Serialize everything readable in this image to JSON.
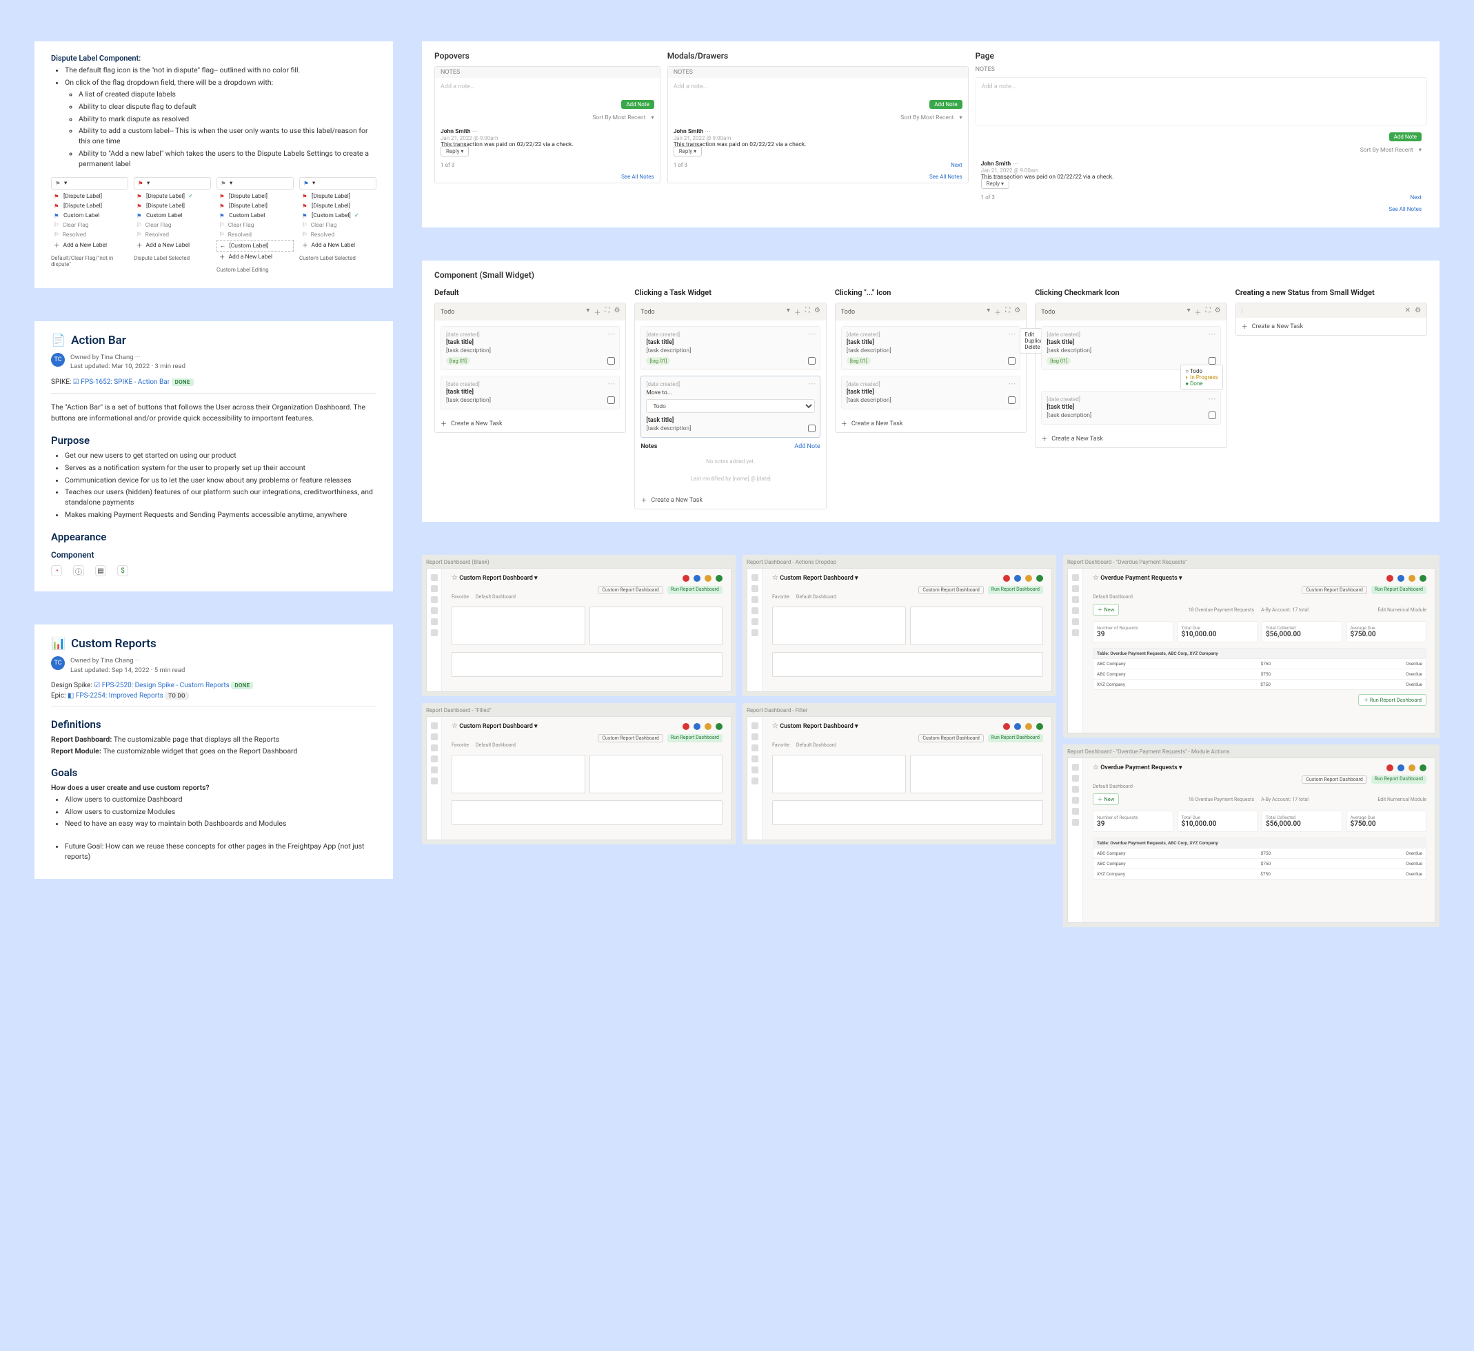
{
  "dispute": {
    "title": "Dispute Label Component:",
    "b1": "The default flag icon is the \"not in dispute\" flag-- outlined with no color fill.",
    "b2": "On click of the flag dropdown field, there will be a dropdown with:",
    "sub1": "A list of created dispute labels",
    "sub2": "Ability to clear dispute flag to default",
    "sub3": "Ability to mark dispute as resolved",
    "sub4": "Ability to add a custom label-- This is when the user only wants to use this label/reason for this one time",
    "sub5": "Ability to \"Add a new label\" which takes the users to the Dispute Labels Settings to create a permanent label",
    "labels": {
      "disp": "[Dispute Label]",
      "custom": "Custom Label",
      "custom_br": "[Custom Label]",
      "clear": "Clear Flag",
      "resolved": "Resolved",
      "addnew": "Add a New Label",
      "cap1": "Default/Clear Flag/\"not in dispute\"",
      "cap2": "Dispute Label Selected",
      "cap3": "Custom Label Editing",
      "cap4": "Custom Label Selected"
    }
  },
  "actionbar": {
    "title": "Action Bar",
    "owner": "Owned by Tina Chang",
    "updated": "Last updated: Mar 10, 2022 · 3 min read",
    "spike_lbl": "SPIKE:",
    "spike_link": "FPS-1652: SPIKE - Action Bar",
    "spike_badge": "DONE",
    "intro": "The \"Action Bar\" is a set of buttons that follows the User across their Organization Dashboard. The buttons are informational and/or provide quick accessibility to important features.",
    "purpose_h": "Purpose",
    "p1": "Get our new users to get started on using our product",
    "p2": "Serves as a notification system for the user to properly set up their account",
    "p3": "Communication device for us to let the user know about any problems or feature releases",
    "p4": "Teaches our users (hidden) features of our platform such our integrations, creditworthiness, and standalone payments",
    "p5": "Makes making Payment Requests and Sending Payments accessible anytime, anywhere",
    "appear_h": "Appearance",
    "comp_h": "Component"
  },
  "custom": {
    "title": "Custom Reports",
    "owner": "Owned by Tina Chang",
    "updated": "Last updated: Sep 14, 2022 · 5 min read",
    "ds_lbl": "Design Spike:",
    "ds_link": "FPS-2520: Design Spike - Custom Reports",
    "ds_badge": "DONE",
    "epic_lbl": "Epic:",
    "epic_link": "FPS-2254: Improved Reports",
    "epic_badge": "TO DO",
    "def_h": "Definitions",
    "def1a": "Report Dashboard:",
    "def1b": "The customizable page that displays all the Reports",
    "def2a": "Report Module:",
    "def2b": "The customizable widget that goes on the Report Dashboard",
    "goals_h": "Goals",
    "gq": "How does a user create and use custom reports?",
    "g1": "Allow users to customize Dashboard",
    "g2": "Allow users to customize Modules",
    "g3": "Need to have an easy way to maintain both Dashboards and Modules",
    "g4": "Future Goal: How can we reuse these concepts for other pages in the Freightpay App (not just reports)"
  },
  "notes": {
    "pop_h": "Popovers",
    "mod_h": "Modals/Drawers",
    "page_h": "Page",
    "label": "NOTES",
    "placeholder": "Add a note…",
    "add": "Add Note",
    "sort": "Sort By Most Recent",
    "author": "John Smith",
    "date": "Jan 21, 2022 @ 9:00am",
    "body1": "This transaction was paid on 02/22/22 via a check.",
    "body2": "This transaction was paid on 02/22/22 via a check.",
    "body3": "This transaction was paid on 02/22/22 via a check.",
    "reply": "Reply",
    "pgl": "1 of 3",
    "next": "Next",
    "seeall": "See All Notes"
  },
  "widgets": {
    "section": "Component (Small Widget)",
    "c1": "Default",
    "c2": "Clicking a Task Widget",
    "c3": "Clicking \"...\" Icon",
    "c4": "Clicking Checkmark Icon",
    "c5": "Creating a new Status from Small Widget",
    "hdr": "Todo",
    "date": "[date created]",
    "title": "[task title]",
    "desc": "[task description]",
    "tag": "[tag 01]",
    "create": "Create a New Task",
    "notes_h": "Notes",
    "addnote": "Add Note",
    "nonotes": "No notes added yet.",
    "modified": "Last modified by [name] @ [date]",
    "moveto": "Move to...",
    "ctx_edit": "Edit",
    "ctx_dup": "Duplicate",
    "ctx_del": "Delete",
    "s1": "Todo",
    "s2": "In Progress",
    "s3": "Done"
  },
  "reports": {
    "r1": "Report Dashboard (Blank)",
    "r2": "Report Dashboard - Actions Dropdop",
    "r3": "Report Dashboard - \"Filled\"",
    "r4": "Report Dashboard - Filter",
    "r5": "Report Dashboard - \"Overdue Payment Requests\"",
    "r6": "Report Dashboard - \"Overdue Payment Requests\" - Module Actions",
    "title_blank": "Custom Report Dashboard",
    "title_opr": "Overdue Payment Requests",
    "default_sub": "Default Dashboard",
    "run_btn": "Run Report Dashboard",
    "actions": "Custom Report Dashboard",
    "fav": "Favorite",
    "new_link": "New",
    "meta": "18 Overdue Payment Requests",
    "acct": "A-By Account: 17 total",
    "edit_num": "Edit Numerical Module",
    "stats": [
      {
        "lbl": "Number of Requests",
        "val": "39"
      },
      {
        "lbl": "Total Due",
        "val": "$10,000.00"
      },
      {
        "lbl": "Total Collected",
        "val": "$56,000.00"
      },
      {
        "lbl": "Average Due",
        "val": "$750.00"
      }
    ],
    "tbl_title": "Table: Overdue Payment Requests, ABC Corp, XYZ Company",
    "rows": [
      [
        "ABC Company",
        "$750",
        "Overdue"
      ],
      [
        "ABC Company",
        "$750",
        "Overdue"
      ],
      [
        "XYZ Company",
        "$750",
        "Overdue"
      ]
    ]
  }
}
